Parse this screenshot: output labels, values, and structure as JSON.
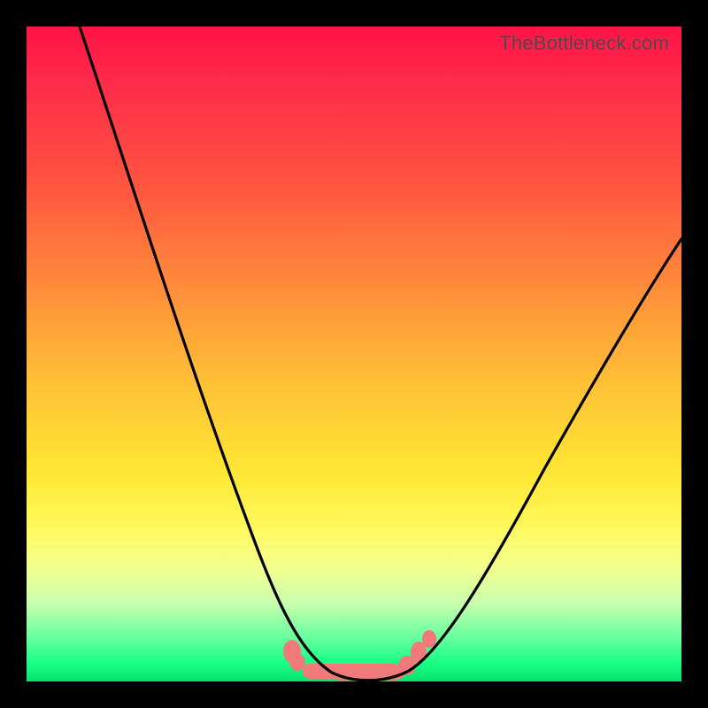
{
  "watermark": "TheBottleneck.com",
  "colors": {
    "frame": "#000000",
    "curve": "#000000",
    "blob": "#ef7a79",
    "gradient_stops": [
      "#ff1446",
      "#ff5740",
      "#ffc236",
      "#fff85a",
      "#1bff85"
    ]
  },
  "chart_data": {
    "type": "line",
    "title": "",
    "xlabel": "",
    "ylabel": "",
    "xlim": [
      0,
      100
    ],
    "ylim": [
      0,
      100
    ],
    "grid": false,
    "legend": false,
    "note": "Numeric axes are not shown; values are estimated positions in percent of plot area (0,0 at bottom-left). The curve is a V/U shape reaching ~0 around x≈47–58.",
    "series": [
      {
        "name": "bottleneck-curve",
        "x": [
          8,
          12,
          16,
          20,
          24,
          28,
          32,
          36,
          40,
          44,
          47,
          50,
          53,
          56,
          58,
          62,
          66,
          70,
          74,
          78,
          82,
          86,
          90,
          94,
          98
        ],
        "y": [
          100,
          90,
          80,
          70,
          60,
          50,
          41,
          32,
          22,
          12,
          4,
          1,
          0,
          1,
          3,
          9,
          17,
          25,
          33,
          40,
          47,
          53,
          59,
          64,
          68
        ]
      }
    ],
    "markers": [
      {
        "name": "valley-blob-cluster",
        "shape": "rounded",
        "approx_x_range": [
          38,
          60
        ],
        "approx_y_range": [
          0,
          8
        ]
      }
    ]
  }
}
